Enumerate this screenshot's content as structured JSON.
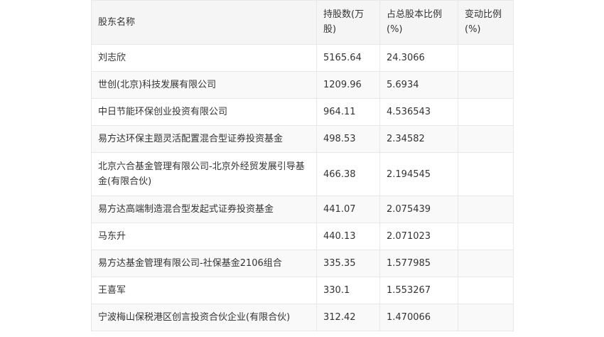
{
  "table": {
    "headers": [
      "股东名称",
      "持股数(万股)",
      "占总股本比例(%)",
      "变动比例(%)"
    ],
    "rows": [
      [
        "刘志欣",
        "5165.64",
        "24.3066",
        ""
      ],
      [
        "世创(北京)科技发展有限公司",
        "1209.96",
        "5.6934",
        ""
      ],
      [
        "中日节能环保创业投资有限公司",
        "964.11",
        "4.536543",
        ""
      ],
      [
        "易方达环保主题灵活配置混合型证券投资基金",
        "498.53",
        "2.34582",
        ""
      ],
      [
        "北京六合基金管理有限公司-北京外经贸发展引导基金(有限合伙)",
        "466.38",
        "2.194545",
        ""
      ],
      [
        "易方达高端制造混合型发起式证券投资基金",
        "441.07",
        "2.075439",
        ""
      ],
      [
        "马东升",
        "440.13",
        "2.071023",
        ""
      ],
      [
        "易方达基金管理有限公司-社保基金2106组合",
        "335.35",
        "1.577985",
        ""
      ],
      [
        "王喜军",
        "330.1",
        "1.553267",
        ""
      ],
      [
        "宁波梅山保税港区创言投资合伙企业(有限合伙)",
        "312.42",
        "1.470066",
        ""
      ]
    ]
  }
}
